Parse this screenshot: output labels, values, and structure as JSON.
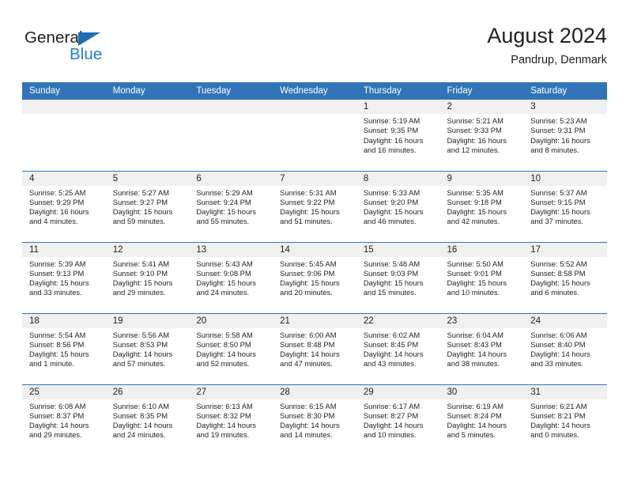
{
  "logo": {
    "word_one": "General",
    "word_two": "Blue",
    "triangle_icon": "triangle-icon",
    "color_dark": "#231f20",
    "color_blue": "#1f7fd0"
  },
  "header": {
    "title": "August 2024",
    "subtitle": "Pandrup, Denmark",
    "accent_color": "#3175b8",
    "daynum_band_color": "#f0f0f0"
  },
  "weekday_headers": [
    "Sunday",
    "Monday",
    "Tuesday",
    "Wednesday",
    "Thursday",
    "Friday",
    "Saturday"
  ],
  "weeks": [
    [
      {
        "day": "",
        "lines": []
      },
      {
        "day": "",
        "lines": []
      },
      {
        "day": "",
        "lines": []
      },
      {
        "day": "",
        "lines": []
      },
      {
        "day": "1",
        "lines": [
          "Sunrise: 5:19 AM",
          "Sunset: 9:35 PM",
          "Daylight: 16 hours",
          "and 16 minutes."
        ]
      },
      {
        "day": "2",
        "lines": [
          "Sunrise: 5:21 AM",
          "Sunset: 9:33 PM",
          "Daylight: 16 hours",
          "and 12 minutes."
        ]
      },
      {
        "day": "3",
        "lines": [
          "Sunrise: 5:23 AM",
          "Sunset: 9:31 PM",
          "Daylight: 16 hours",
          "and 8 minutes."
        ]
      }
    ],
    [
      {
        "day": "4",
        "lines": [
          "Sunrise: 5:25 AM",
          "Sunset: 9:29 PM",
          "Daylight: 16 hours",
          "and 4 minutes."
        ]
      },
      {
        "day": "5",
        "lines": [
          "Sunrise: 5:27 AM",
          "Sunset: 9:27 PM",
          "Daylight: 15 hours",
          "and 59 minutes."
        ]
      },
      {
        "day": "6",
        "lines": [
          "Sunrise: 5:29 AM",
          "Sunset: 9:24 PM",
          "Daylight: 15 hours",
          "and 55 minutes."
        ]
      },
      {
        "day": "7",
        "lines": [
          "Sunrise: 5:31 AM",
          "Sunset: 9:22 PM",
          "Daylight: 15 hours",
          "and 51 minutes."
        ]
      },
      {
        "day": "8",
        "lines": [
          "Sunrise: 5:33 AM",
          "Sunset: 9:20 PM",
          "Daylight: 15 hours",
          "and 46 minutes."
        ]
      },
      {
        "day": "9",
        "lines": [
          "Sunrise: 5:35 AM",
          "Sunset: 9:18 PM",
          "Daylight: 15 hours",
          "and 42 minutes."
        ]
      },
      {
        "day": "10",
        "lines": [
          "Sunrise: 5:37 AM",
          "Sunset: 9:15 PM",
          "Daylight: 15 hours",
          "and 37 minutes."
        ]
      }
    ],
    [
      {
        "day": "11",
        "lines": [
          "Sunrise: 5:39 AM",
          "Sunset: 9:13 PM",
          "Daylight: 15 hours",
          "and 33 minutes."
        ]
      },
      {
        "day": "12",
        "lines": [
          "Sunrise: 5:41 AM",
          "Sunset: 9:10 PM",
          "Daylight: 15 hours",
          "and 29 minutes."
        ]
      },
      {
        "day": "13",
        "lines": [
          "Sunrise: 5:43 AM",
          "Sunset: 9:08 PM",
          "Daylight: 15 hours",
          "and 24 minutes."
        ]
      },
      {
        "day": "14",
        "lines": [
          "Sunrise: 5:45 AM",
          "Sunset: 9:06 PM",
          "Daylight: 15 hours",
          "and 20 minutes."
        ]
      },
      {
        "day": "15",
        "lines": [
          "Sunrise: 5:48 AM",
          "Sunset: 9:03 PM",
          "Daylight: 15 hours",
          "and 15 minutes."
        ]
      },
      {
        "day": "16",
        "lines": [
          "Sunrise: 5:50 AM",
          "Sunset: 9:01 PM",
          "Daylight: 15 hours",
          "and 10 minutes."
        ]
      },
      {
        "day": "17",
        "lines": [
          "Sunrise: 5:52 AM",
          "Sunset: 8:58 PM",
          "Daylight: 15 hours",
          "and 6 minutes."
        ]
      }
    ],
    [
      {
        "day": "18",
        "lines": [
          "Sunrise: 5:54 AM",
          "Sunset: 8:56 PM",
          "Daylight: 15 hours",
          "and 1 minute."
        ]
      },
      {
        "day": "19",
        "lines": [
          "Sunrise: 5:56 AM",
          "Sunset: 8:53 PM",
          "Daylight: 14 hours",
          "and 57 minutes."
        ]
      },
      {
        "day": "20",
        "lines": [
          "Sunrise: 5:58 AM",
          "Sunset: 8:50 PM",
          "Daylight: 14 hours",
          "and 52 minutes."
        ]
      },
      {
        "day": "21",
        "lines": [
          "Sunrise: 6:00 AM",
          "Sunset: 8:48 PM",
          "Daylight: 14 hours",
          "and 47 minutes."
        ]
      },
      {
        "day": "22",
        "lines": [
          "Sunrise: 6:02 AM",
          "Sunset: 8:45 PM",
          "Daylight: 14 hours",
          "and 43 minutes."
        ]
      },
      {
        "day": "23",
        "lines": [
          "Sunrise: 6:04 AM",
          "Sunset: 8:43 PM",
          "Daylight: 14 hours",
          "and 38 minutes."
        ]
      },
      {
        "day": "24",
        "lines": [
          "Sunrise: 6:06 AM",
          "Sunset: 8:40 PM",
          "Daylight: 14 hours",
          "and 33 minutes."
        ]
      }
    ],
    [
      {
        "day": "25",
        "lines": [
          "Sunrise: 6:08 AM",
          "Sunset: 8:37 PM",
          "Daylight: 14 hours",
          "and 29 minutes."
        ]
      },
      {
        "day": "26",
        "lines": [
          "Sunrise: 6:10 AM",
          "Sunset: 8:35 PM",
          "Daylight: 14 hours",
          "and 24 minutes."
        ]
      },
      {
        "day": "27",
        "lines": [
          "Sunrise: 6:13 AM",
          "Sunset: 8:32 PM",
          "Daylight: 14 hours",
          "and 19 minutes."
        ]
      },
      {
        "day": "28",
        "lines": [
          "Sunrise: 6:15 AM",
          "Sunset: 8:30 PM",
          "Daylight: 14 hours",
          "and 14 minutes."
        ]
      },
      {
        "day": "29",
        "lines": [
          "Sunrise: 6:17 AM",
          "Sunset: 8:27 PM",
          "Daylight: 14 hours",
          "and 10 minutes."
        ]
      },
      {
        "day": "30",
        "lines": [
          "Sunrise: 6:19 AM",
          "Sunset: 8:24 PM",
          "Daylight: 14 hours",
          "and 5 minutes."
        ]
      },
      {
        "day": "31",
        "lines": [
          "Sunrise: 6:21 AM",
          "Sunset: 8:21 PM",
          "Daylight: 14 hours",
          "and 0 minutes."
        ]
      }
    ]
  ]
}
